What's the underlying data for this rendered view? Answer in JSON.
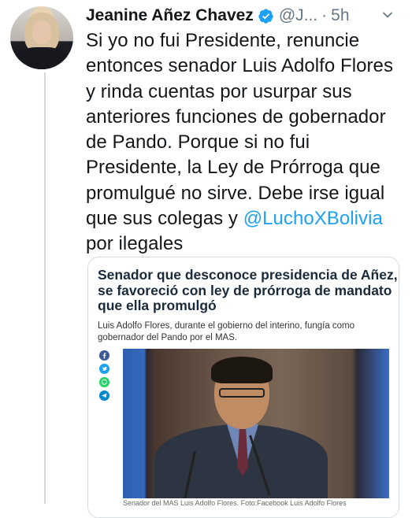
{
  "tweet": {
    "author_name": "Jeanine Añez Chavez",
    "handle": "@J...",
    "separator": "·",
    "time": "5h",
    "text_lines": [
      "Si yo no fui Presidente, renuncie",
      "entonces senador Luis Adolfo Flores",
      "y rinda cuentas por usurpar sus",
      "anteriores funciones de gobernador",
      "de Pando. Porque si no fui",
      "Presidente, la Ley de Prórroga que",
      "promulgué no sirve. Debe irse igual",
      "que sus colegas y ",
      "por ilegales"
    ],
    "mention": "@LuchoXBolivia"
  },
  "card": {
    "headline_lines": [
      "Senador que desconoce presidencia de Añez,",
      "se favoreció con ley de prórroga de mandato",
      "que ella promulgó"
    ],
    "sub_lines": [
      "Luis Adolfo Flores, durante el gobierno del interino, fungía como",
      "gobernador del Pando por el MAS."
    ],
    "caption": "Senador del MAS Luis Adolfo Flores. Foto:Facebook Luis Adolfo Flores",
    "share_icons": [
      "facebook-icon",
      "twitter-icon",
      "whatsapp-icon",
      "telegram-icon"
    ]
  },
  "colors": {
    "link": "#1da1f2",
    "verified": "#1da1f2",
    "muted": "#657786",
    "headline": "#1b2a3a"
  }
}
